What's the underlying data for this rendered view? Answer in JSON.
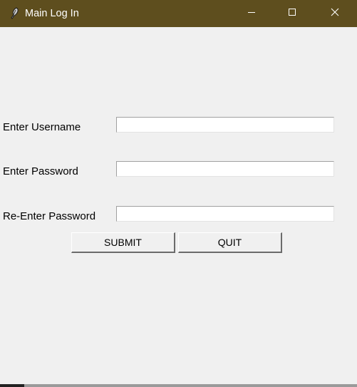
{
  "window": {
    "title": "Main Log In",
    "titlebar_color": "#5e4e1e",
    "icon": "feather-icon",
    "controls": [
      "minimize-icon",
      "maximize-icon",
      "close-icon"
    ]
  },
  "form": {
    "username_label": "Enter Username",
    "username_value": "",
    "password_label": "Enter Password",
    "password_value": "",
    "reenter_label": "Re-Enter Password",
    "reenter_value": "",
    "submit_label": "SUBMIT",
    "quit_label": "QUIT"
  }
}
